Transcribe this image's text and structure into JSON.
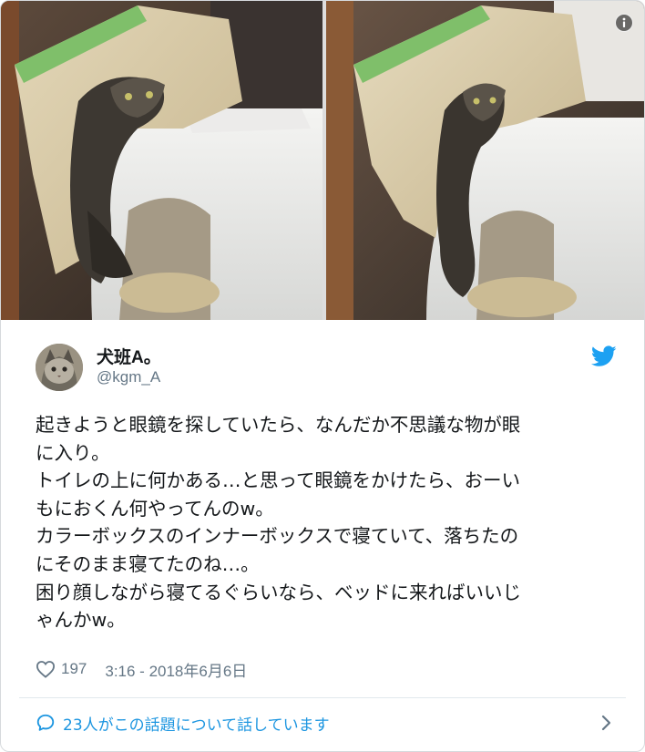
{
  "author": {
    "display_name": "犬班A。",
    "handle": "@kgm_A"
  },
  "tweet": {
    "lines": [
      "起きようと眼鏡を探していたら、なんだか不思議な物が眼",
      "に入り。",
      "トイレの上に何かある…と思って眼鏡をかけたら、おーい",
      "もにおくん何やってんのw。",
      "カラーボックスのインナーボックスで寝ていて、落ちたの",
      "にそのまま寝てたのね…。",
      "困り顔しながら寝てるぐらいなら、ベッドに来ればいいじ",
      "ゃんかw。"
    ]
  },
  "meta": {
    "like_count": "197",
    "timestamp": "3:16 - 2018年6月6日"
  },
  "footer": {
    "conversation_label": "23人がこの話題について話しています"
  },
  "icons": {
    "heart": "heart-icon",
    "twitter": "twitter-bird-icon",
    "info": "info-icon",
    "comment": "comment-icon",
    "chevron": "chevron-right-icon"
  },
  "colors": {
    "twitter_blue": "#1da1f2",
    "link_blue": "#1b95e0",
    "secondary_text": "#657786",
    "primary_text": "#14171a",
    "border": "#e1e8ed"
  }
}
